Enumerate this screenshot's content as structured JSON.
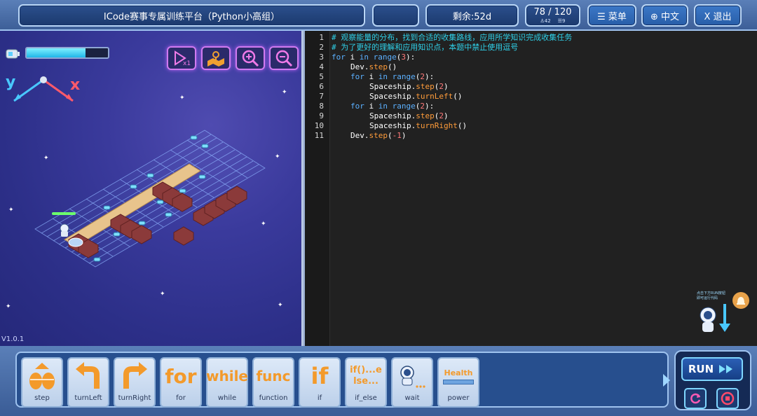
{
  "header": {
    "title": "ICode赛事专属训练平台（Python小高组）",
    "blank": "",
    "remaining": "剩余:52d",
    "progress": "78 / 120",
    "stat_likes": "42",
    "stat_list": "9",
    "menu_label": "☰ 菜单",
    "lang_label": "⊕ 中文",
    "exit_label": "X 退出"
  },
  "game": {
    "energy_level": 0.72,
    "axis_y": "y",
    "axis_x": "x",
    "version": "V1.0.1",
    "tools": [
      "speed-icon",
      "map-icon",
      "zoom-in-icon",
      "zoom-out-icon"
    ]
  },
  "editor": {
    "lines": [
      {
        "n": "1",
        "indent": 0,
        "tokens": [
          [
            "cm",
            "# 观察能量的分布，找到合适的收集路线，应用所学知识完成收集任务"
          ]
        ]
      },
      {
        "n": "2",
        "indent": 0,
        "tokens": [
          [
            "cm",
            "# 为了更好的理解和应用知识点，本题中禁止使用逗号"
          ]
        ]
      },
      {
        "n": "3",
        "indent": 0,
        "tokens": [
          [
            "kw",
            "for"
          ],
          [
            "tx",
            " i "
          ],
          [
            "kw",
            "in"
          ],
          [
            "tx",
            " "
          ],
          [
            "kw",
            "range"
          ],
          [
            "tx",
            "("
          ],
          [
            "nm",
            "3"
          ],
          [
            "tx",
            "):"
          ]
        ]
      },
      {
        "n": "4",
        "indent": 1,
        "tokens": [
          [
            "tx",
            "Dev."
          ],
          [
            "fn",
            "step"
          ],
          [
            "tx",
            "()"
          ]
        ]
      },
      {
        "n": "5",
        "indent": 1,
        "tokens": [
          [
            "kw",
            "for"
          ],
          [
            "tx",
            " i "
          ],
          [
            "kw",
            "in"
          ],
          [
            "tx",
            " "
          ],
          [
            "kw",
            "range"
          ],
          [
            "tx",
            "("
          ],
          [
            "nm",
            "2"
          ],
          [
            "tx",
            "):"
          ]
        ]
      },
      {
        "n": "6",
        "indent": 2,
        "tokens": [
          [
            "tx",
            "Spaceship."
          ],
          [
            "fn",
            "step"
          ],
          [
            "tx",
            "("
          ],
          [
            "nm",
            "2"
          ],
          [
            "tx",
            ")"
          ]
        ]
      },
      {
        "n": "7",
        "indent": 2,
        "tokens": [
          [
            "tx",
            "Spaceship."
          ],
          [
            "fn",
            "turnLeft"
          ],
          [
            "tx",
            "()"
          ]
        ]
      },
      {
        "n": "8",
        "indent": 1,
        "tokens": [
          [
            "kw",
            "for"
          ],
          [
            "tx",
            " i "
          ],
          [
            "kw",
            "in"
          ],
          [
            "tx",
            " "
          ],
          [
            "kw",
            "range"
          ],
          [
            "tx",
            "("
          ],
          [
            "nm",
            "2"
          ],
          [
            "tx",
            "):"
          ]
        ]
      },
      {
        "n": "9",
        "indent": 2,
        "tokens": [
          [
            "tx",
            "Spaceship."
          ],
          [
            "fn",
            "step"
          ],
          [
            "tx",
            "("
          ],
          [
            "nm",
            "2"
          ],
          [
            "tx",
            ")"
          ]
        ]
      },
      {
        "n": "10",
        "indent": 2,
        "tokens": [
          [
            "tx",
            "Spaceship."
          ],
          [
            "fn",
            "turnRight"
          ],
          [
            "tx",
            "()"
          ]
        ]
      },
      {
        "n": "11",
        "indent": 1,
        "tokens": [
          [
            "tx",
            "Dev."
          ],
          [
            "fn",
            "step"
          ],
          [
            "tx",
            "("
          ],
          [
            "nm",
            "-1"
          ],
          [
            "tx",
            ")"
          ]
        ]
      }
    ],
    "assistant_hint_1": "点击下方RUN按钮",
    "assistant_hint_2": "即可运行代码"
  },
  "blocks": [
    {
      "label": "step",
      "glyph": "step-icon"
    },
    {
      "label": "turnLeft",
      "glyph": "turn-left-icon"
    },
    {
      "label": "turnRight",
      "glyph": "turn-right-icon"
    },
    {
      "label": "for",
      "glyph": "for"
    },
    {
      "label": "while",
      "glyph": "while"
    },
    {
      "label": "function",
      "glyph": "func"
    },
    {
      "label": "if",
      "glyph": "if"
    },
    {
      "label": "if_else",
      "glyph": "if()...else..."
    },
    {
      "label": "wait",
      "glyph": "wait-icon"
    },
    {
      "label": "power",
      "glyph": "Health"
    }
  ],
  "run_panel": {
    "run_label": "RUN"
  },
  "colors": {
    "comment": "#2fd0e8",
    "keyword": "#5bb0ff",
    "function": "#ff9c3a",
    "number": "#ff7a7a",
    "block_orange": "#f39a2b"
  }
}
